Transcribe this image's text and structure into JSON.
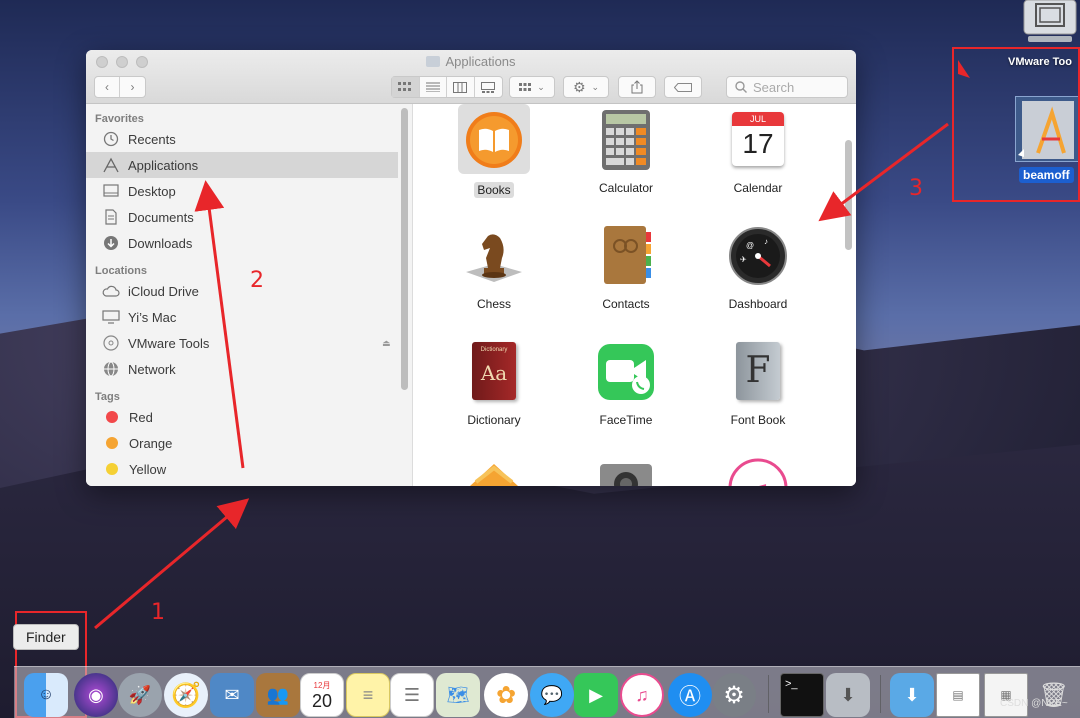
{
  "window": {
    "title": "Applications",
    "search_placeholder": "Search"
  },
  "sidebar": {
    "favorites_header": "Favorites",
    "favorites": [
      {
        "label": "Recents"
      },
      {
        "label": "Applications"
      },
      {
        "label": "Desktop"
      },
      {
        "label": "Documents"
      },
      {
        "label": "Downloads"
      }
    ],
    "locations_header": "Locations",
    "locations": [
      {
        "label": "iCloud Drive"
      },
      {
        "label": "Yi’s Mac"
      },
      {
        "label": "VMware Tools"
      },
      {
        "label": "Network"
      }
    ],
    "tags_header": "Tags",
    "tags": [
      {
        "label": "Red",
        "color": "#f2484a"
      },
      {
        "label": "Orange",
        "color": "#f5a432"
      },
      {
        "label": "Yellow",
        "color": "#f5d034"
      }
    ]
  },
  "apps": [
    {
      "label": "Books"
    },
    {
      "label": "Calculator"
    },
    {
      "label": "Calendar",
      "month": "JUL",
      "day": "17"
    },
    {
      "label": "Chess"
    },
    {
      "label": "Contacts"
    },
    {
      "label": "Dashboard"
    },
    {
      "label": "Dictionary",
      "badge": "Aa",
      "subtitle": "Dictionary"
    },
    {
      "label": "FaceTime"
    },
    {
      "label": "Font Book",
      "badge": "F"
    }
  ],
  "desktop": {
    "vmware_label": "VMware Too",
    "beamoff_label": "beamoff"
  },
  "annotations": {
    "one": "1",
    "two": "2",
    "three": "3"
  },
  "dock": {
    "tooltip": "Finder",
    "calendar_day": "20",
    "calendar_month": "12月"
  },
  "watermark": "CSDN @NPE~",
  "colors": {
    "annotation_red": "#e8262a",
    "selection_blue": "#1c5fcf"
  }
}
